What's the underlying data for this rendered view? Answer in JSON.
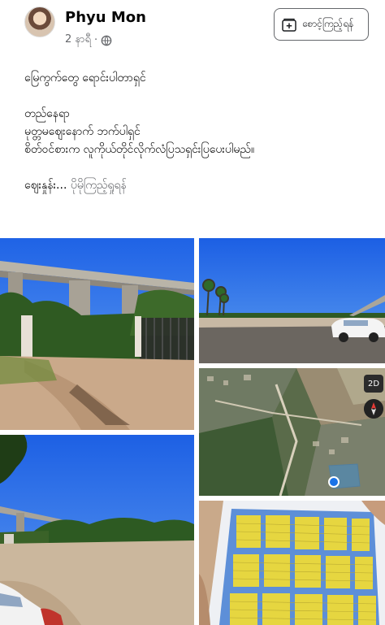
{
  "post": {
    "author": "Phyu Mon",
    "time": "2 နာရီ",
    "dot": "·",
    "save_button": "စောင့်ကြည့်ရန်",
    "text_lines": [
      "မြေကွက်တွေ ရောင်းပါတာရှင်",
      "",
      "တည်နေရာ",
      "မုတ္တမဈေးနောက် ဘက်ပါရှင်",
      "စိတ်ဝင်စားက လူကိုယ်တိုင်လိုက်လံပြသရှင်းပြပေးပါမည်။",
      "",
      "ဈေးနှုန်း..."
    ],
    "see_more": "ပိုမိုကြည့်ရှုရန်",
    "map_badge": "2D"
  },
  "colors": {
    "secondary_text": "#65676b",
    "primary_text": "#050505",
    "sky_blue": "#2a6be0"
  },
  "icons": [
    "globe-icon",
    "bookmark-plus-icon",
    "compass-icon"
  ]
}
